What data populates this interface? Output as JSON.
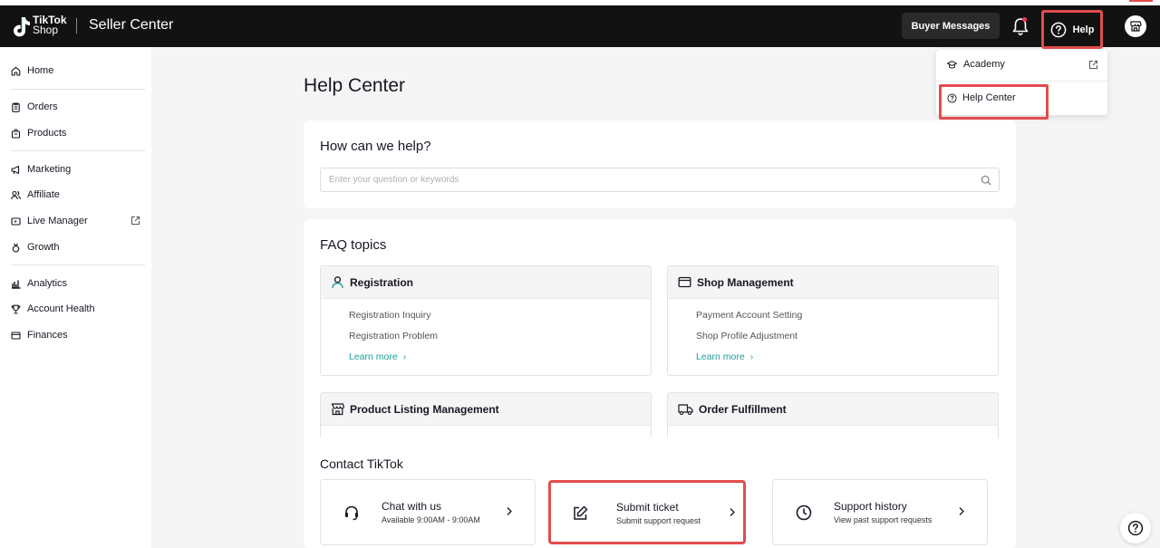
{
  "header": {
    "logo_top": "TikTok",
    "logo_bottom": "Shop",
    "product": "Seller Center",
    "buyer_messages": "Buyer Messages",
    "help_label": "Help",
    "icons": [
      "tiktok-note-icon",
      "bell-icon",
      "help-circle-icon",
      "store-icon"
    ],
    "notification_dot_color": "#fe2c55"
  },
  "sidebar": {
    "items": [
      {
        "label": "Home",
        "icon": "home-icon"
      },
      {
        "label": "Orders",
        "icon": "clipboard-icon"
      },
      {
        "label": "Products",
        "icon": "bag-icon"
      },
      {
        "label": "Marketing",
        "icon": "megaphone-icon"
      },
      {
        "label": "Affiliate",
        "icon": "users-icon"
      },
      {
        "label": "Live Manager",
        "icon": "live-icon"
      },
      {
        "label": "Growth",
        "icon": "medal-icon"
      },
      {
        "label": "Analytics",
        "icon": "chart-icon"
      },
      {
        "label": "Account Health",
        "icon": "trophy-icon"
      },
      {
        "label": "Finances",
        "icon": "wallet-icon"
      }
    ]
  },
  "main": {
    "title": "Help Center",
    "help_card": {
      "heading": "How can we help?",
      "search_placeholder": "Enter your question or keywords"
    },
    "faq": {
      "heading": "FAQ topics",
      "topics": [
        {
          "title": "Registration",
          "links": [
            "Registration Inquiry",
            "Registration Problem"
          ],
          "more": "Learn more"
        },
        {
          "title": "Shop Management",
          "links": [
            "Payment Account Setting",
            "Shop Profile Adjustment"
          ],
          "more": "Learn more"
        },
        {
          "title": "Product Listing Management"
        },
        {
          "title": "Order Fulfillment"
        }
      ]
    },
    "contact": {
      "heading": "Contact TikTok",
      "cards": [
        {
          "title": "Chat with us",
          "sub": "Available 9:00AM - 9:00AM",
          "icon": "headset-icon"
        },
        {
          "title": "Submit ticket",
          "sub": "Submit support request",
          "icon": "edit-icon"
        },
        {
          "title": "Support history",
          "sub": "View past support requests",
          "icon": "clock-icon"
        }
      ]
    }
  },
  "help_menu": {
    "items": [
      {
        "label": "Academy",
        "icon": "graduation-cap-icon"
      },
      {
        "label": "Help Center",
        "icon": "help-circle-icon"
      }
    ]
  },
  "colors": {
    "header_bg": "#121212",
    "accent_teal": "#1b9e9b",
    "highlight_red": "#e34c4c"
  }
}
